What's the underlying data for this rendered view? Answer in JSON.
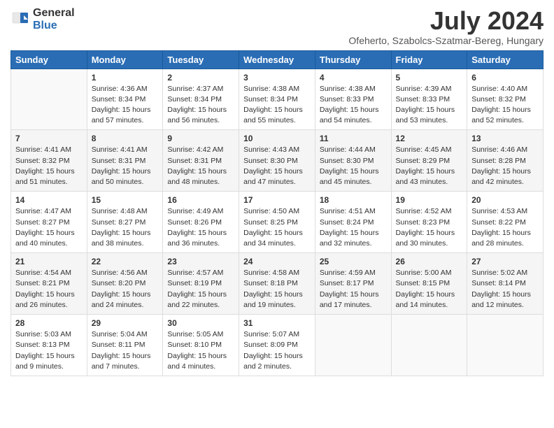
{
  "logo": {
    "general": "General",
    "blue": "Blue"
  },
  "title": "July 2024",
  "subtitle": "Ofeherto, Szabolcs-Szatmar-Bereg, Hungary",
  "days_of_week": [
    "Sunday",
    "Monday",
    "Tuesday",
    "Wednesday",
    "Thursday",
    "Friday",
    "Saturday"
  ],
  "weeks": [
    [
      {
        "day": null,
        "info": null
      },
      {
        "day": "1",
        "info": "Sunrise: 4:36 AM\nSunset: 8:34 PM\nDaylight: 15 hours\nand 57 minutes."
      },
      {
        "day": "2",
        "info": "Sunrise: 4:37 AM\nSunset: 8:34 PM\nDaylight: 15 hours\nand 56 minutes."
      },
      {
        "day": "3",
        "info": "Sunrise: 4:38 AM\nSunset: 8:34 PM\nDaylight: 15 hours\nand 55 minutes."
      },
      {
        "day": "4",
        "info": "Sunrise: 4:38 AM\nSunset: 8:33 PM\nDaylight: 15 hours\nand 54 minutes."
      },
      {
        "day": "5",
        "info": "Sunrise: 4:39 AM\nSunset: 8:33 PM\nDaylight: 15 hours\nand 53 minutes."
      },
      {
        "day": "6",
        "info": "Sunrise: 4:40 AM\nSunset: 8:32 PM\nDaylight: 15 hours\nand 52 minutes."
      }
    ],
    [
      {
        "day": "7",
        "info": "Sunrise: 4:41 AM\nSunset: 8:32 PM\nDaylight: 15 hours\nand 51 minutes."
      },
      {
        "day": "8",
        "info": "Sunrise: 4:41 AM\nSunset: 8:31 PM\nDaylight: 15 hours\nand 50 minutes."
      },
      {
        "day": "9",
        "info": "Sunrise: 4:42 AM\nSunset: 8:31 PM\nDaylight: 15 hours\nand 48 minutes."
      },
      {
        "day": "10",
        "info": "Sunrise: 4:43 AM\nSunset: 8:30 PM\nDaylight: 15 hours\nand 47 minutes."
      },
      {
        "day": "11",
        "info": "Sunrise: 4:44 AM\nSunset: 8:30 PM\nDaylight: 15 hours\nand 45 minutes."
      },
      {
        "day": "12",
        "info": "Sunrise: 4:45 AM\nSunset: 8:29 PM\nDaylight: 15 hours\nand 43 minutes."
      },
      {
        "day": "13",
        "info": "Sunrise: 4:46 AM\nSunset: 8:28 PM\nDaylight: 15 hours\nand 42 minutes."
      }
    ],
    [
      {
        "day": "14",
        "info": "Sunrise: 4:47 AM\nSunset: 8:27 PM\nDaylight: 15 hours\nand 40 minutes."
      },
      {
        "day": "15",
        "info": "Sunrise: 4:48 AM\nSunset: 8:27 PM\nDaylight: 15 hours\nand 38 minutes."
      },
      {
        "day": "16",
        "info": "Sunrise: 4:49 AM\nSunset: 8:26 PM\nDaylight: 15 hours\nand 36 minutes."
      },
      {
        "day": "17",
        "info": "Sunrise: 4:50 AM\nSunset: 8:25 PM\nDaylight: 15 hours\nand 34 minutes."
      },
      {
        "day": "18",
        "info": "Sunrise: 4:51 AM\nSunset: 8:24 PM\nDaylight: 15 hours\nand 32 minutes."
      },
      {
        "day": "19",
        "info": "Sunrise: 4:52 AM\nSunset: 8:23 PM\nDaylight: 15 hours\nand 30 minutes."
      },
      {
        "day": "20",
        "info": "Sunrise: 4:53 AM\nSunset: 8:22 PM\nDaylight: 15 hours\nand 28 minutes."
      }
    ],
    [
      {
        "day": "21",
        "info": "Sunrise: 4:54 AM\nSunset: 8:21 PM\nDaylight: 15 hours\nand 26 minutes."
      },
      {
        "day": "22",
        "info": "Sunrise: 4:56 AM\nSunset: 8:20 PM\nDaylight: 15 hours\nand 24 minutes."
      },
      {
        "day": "23",
        "info": "Sunrise: 4:57 AM\nSunset: 8:19 PM\nDaylight: 15 hours\nand 22 minutes."
      },
      {
        "day": "24",
        "info": "Sunrise: 4:58 AM\nSunset: 8:18 PM\nDaylight: 15 hours\nand 19 minutes."
      },
      {
        "day": "25",
        "info": "Sunrise: 4:59 AM\nSunset: 8:17 PM\nDaylight: 15 hours\nand 17 minutes."
      },
      {
        "day": "26",
        "info": "Sunrise: 5:00 AM\nSunset: 8:15 PM\nDaylight: 15 hours\nand 14 minutes."
      },
      {
        "day": "27",
        "info": "Sunrise: 5:02 AM\nSunset: 8:14 PM\nDaylight: 15 hours\nand 12 minutes."
      }
    ],
    [
      {
        "day": "28",
        "info": "Sunrise: 5:03 AM\nSunset: 8:13 PM\nDaylight: 15 hours\nand 9 minutes."
      },
      {
        "day": "29",
        "info": "Sunrise: 5:04 AM\nSunset: 8:11 PM\nDaylight: 15 hours\nand 7 minutes."
      },
      {
        "day": "30",
        "info": "Sunrise: 5:05 AM\nSunset: 8:10 PM\nDaylight: 15 hours\nand 4 minutes."
      },
      {
        "day": "31",
        "info": "Sunrise: 5:07 AM\nSunset: 8:09 PM\nDaylight: 15 hours\nand 2 minutes."
      },
      {
        "day": null,
        "info": null
      },
      {
        "day": null,
        "info": null
      },
      {
        "day": null,
        "info": null
      }
    ]
  ]
}
